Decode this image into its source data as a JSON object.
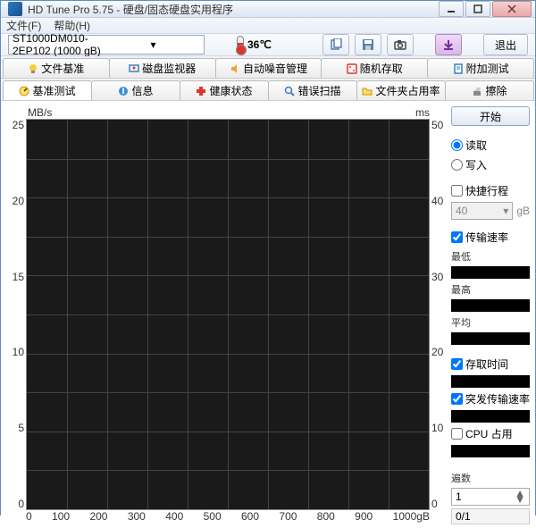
{
  "window": {
    "title": "HD Tune Pro 5.75 - 硬盘/固态硬盘实用程序"
  },
  "menu": {
    "file": "文件(F)",
    "help": "帮助(H)"
  },
  "toolbar": {
    "drive_selected": "ST1000DM010-2EP102 (1000 gB)",
    "temperature": "36℃",
    "exit_label": "退出"
  },
  "tabs_row1": [
    {
      "label": "文件基准"
    },
    {
      "label": "磁盘监视器"
    },
    {
      "label": "自动噪音管理"
    },
    {
      "label": "随机存取"
    },
    {
      "label": "附加测试"
    }
  ],
  "tabs_row2": [
    {
      "label": "基准测试"
    },
    {
      "label": "信息"
    },
    {
      "label": "健康状态"
    },
    {
      "label": "错误扫描"
    },
    {
      "label": "文件夹占用率"
    },
    {
      "label": "擦除"
    }
  ],
  "chart_data": {
    "type": "line",
    "title": "",
    "y_left_unit": "MB/s",
    "y_right_unit": "ms",
    "x_unit": "gB",
    "y_left_ticks": [
      25,
      20,
      15,
      10,
      5,
      0
    ],
    "y_right_ticks": [
      50,
      40,
      30,
      20,
      10,
      0
    ],
    "x_ticks": [
      0,
      100,
      200,
      300,
      400,
      500,
      600,
      700,
      800,
      900,
      1000
    ],
    "series": []
  },
  "side": {
    "start_label": "开始",
    "read_label": "读取",
    "write_label": "写入",
    "quick_label": "快捷行程",
    "quick_value": "40",
    "quick_unit": "gB",
    "transfer_rate_label": "传输速率",
    "min_label": "最低",
    "max_label": "最高",
    "avg_label": "平均",
    "access_time_label": "存取时间",
    "burst_rate_label": "突发传输速率",
    "cpu_label": "CPU 占用",
    "passes_label": "遍数",
    "passes_value": "1",
    "progress_value": "0/1"
  }
}
